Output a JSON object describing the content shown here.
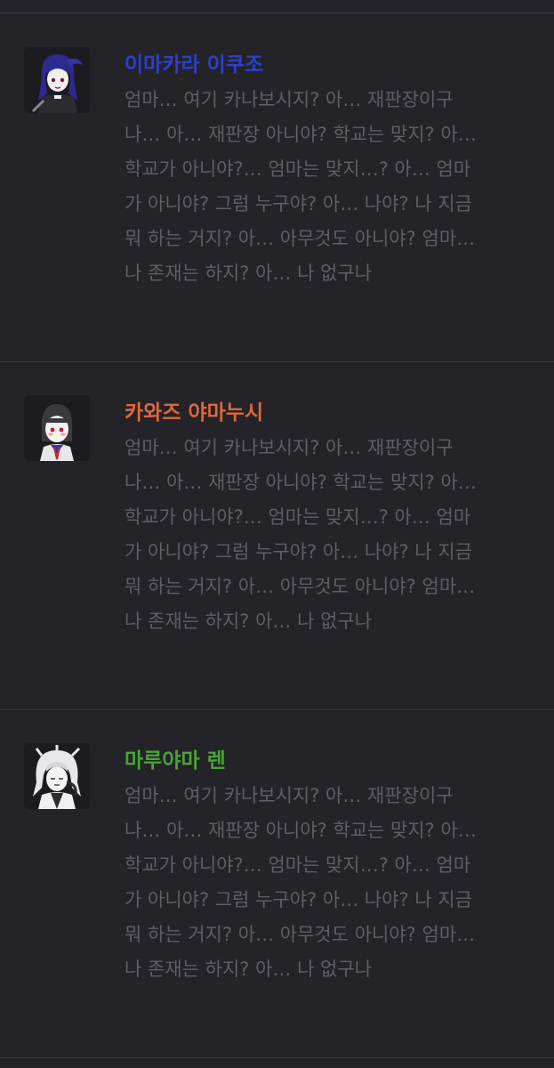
{
  "posts": [
    {
      "name": "이마카라 이쿠조",
      "name_color": "#2b3fd2",
      "avatar": "character-portrait-icon",
      "lines": [
        "엄마… 여기 카나보시지? 아… 재판장이구",
        "나… 아… 재판장 아니야? 학교는 맞지? 아…",
        "학교가 아니야?… 엄마는 맞지…? 아… 엄마",
        "가 아니야? 그럼 누구야? 아… 나야? 나 지금",
        "뭐 하는 거지? 아… 아무것도 아니야? 엄마…",
        "나 존재는 하지? 아… 나 없구나"
      ]
    },
    {
      "name": "카와즈 야마누시",
      "name_color": "#e0663e",
      "avatar": "character-portrait-icon",
      "lines": [
        "엄마… 여기 카나보시지? 아… 재판장이구",
        "나… 아… 재판장 아니야? 학교는 맞지? 아…",
        "학교가 아니야?… 엄마는 맞지…? 아… 엄마",
        "가 아니야? 그럼 누구야? 아… 나야? 나 지금",
        "뭐 하는 거지? 아… 아무것도 아니야? 엄마…",
        "나 존재는 하지? 아… 나 없구나"
      ]
    },
    {
      "name": "마루야마 렌",
      "name_color": "#47a535",
      "avatar": "character-portrait-icon",
      "lines": [
        "엄마… 여기 카나보시지? 아… 재판장이구",
        "나… 아… 재판장 아니야? 학교는 맞지? 아…",
        "학교가 아니야?… 엄마는 맞지…? 아… 엄마",
        "가 아니야? 그럼 누구야? 아… 나야? 나 지금",
        "뭐 하는 거지? 아… 아무것도 아니야? 엄마…",
        "나 존재는 하지? 아… 나 없구나"
      ]
    }
  ]
}
